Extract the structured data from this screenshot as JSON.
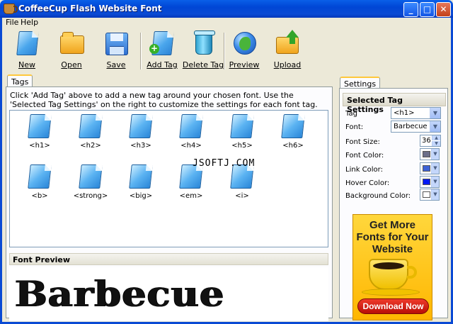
{
  "window": {
    "title": "CoffeeCup Flash Website Font",
    "minimize": "_",
    "maximize": "□",
    "close": "✕"
  },
  "menu": [
    "File",
    "Help"
  ],
  "toolbar": {
    "new": "New",
    "open": "Open",
    "save": "Save",
    "add_tag": "Add Tag",
    "delete_tag": "Delete Tag",
    "preview": "Preview",
    "upload": "Upload"
  },
  "tags_panel": {
    "tab": "Tags",
    "hint": "Click 'Add Tag' above to add a new tag around your chosen font.  Use the 'Selected Tag Settings' on the right to customize the settings for each font tag.",
    "items": [
      "<h1>",
      "<h2>",
      "<h3>",
      "<h4>",
      "<h5>",
      "<h6>",
      "<b>",
      "<strong>",
      "<big>",
      "<em>",
      "<i>"
    ]
  },
  "watermark": "JSOFTJ.COM",
  "font_preview": {
    "header": "Font Preview",
    "sample": "Barbecue"
  },
  "settings": {
    "tab": "Settings",
    "header": "Selected Tag Settings",
    "tag_label": "Tag",
    "tag_value": "<h1>",
    "font_label": "Font:",
    "font_value": "Barbecue",
    "font_size_label": "Font Size:",
    "font_size_value": "36",
    "font_color_label": "Font Color:",
    "link_color_label": "Link Color:",
    "hover_color_label": "Hover Color:",
    "background_color_label": "Background Color:",
    "colors": {
      "font": "#6b6f8a",
      "link": "#3d62d6",
      "hover": "#0019f5",
      "background": "#ffffff"
    }
  },
  "ad": {
    "line1": "Get More",
    "line2": "Fonts for Your",
    "line3": "Website",
    "button": "Download Now"
  }
}
